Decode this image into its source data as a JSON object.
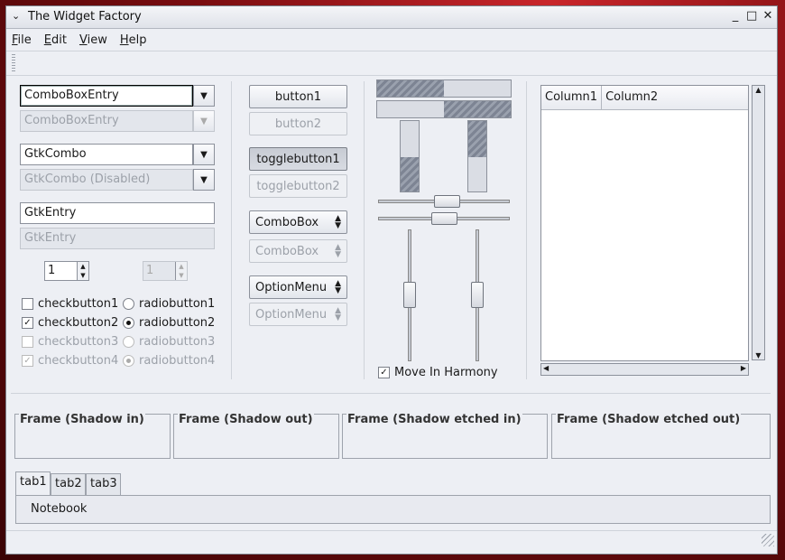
{
  "window": {
    "title": "The Widget Factory",
    "controls": [
      "_",
      "□",
      "✕"
    ]
  },
  "menu": [
    "File",
    "Edit",
    "View",
    "Help"
  ],
  "left": {
    "combobox_entry": "ComboBoxEntry",
    "combobox_entry_disabled": "ComboBoxEntry",
    "gtkcombo": "GtkCombo",
    "gtkcombo_disabled": "GtkCombo (Disabled)",
    "gtkentry": "GtkEntry",
    "gtkentry_disabled": "GtkEntry",
    "spin_value": "1",
    "spin_disabled_value": "1",
    "checks": [
      "checkbutton1",
      "checkbutton2",
      "checkbutton3",
      "checkbutton4"
    ],
    "radios": [
      "radiobutton1",
      "radiobutton2",
      "radiobutton3",
      "radiobutton4"
    ]
  },
  "middle": {
    "button1": "button1",
    "button2": "button2",
    "toggle1": "togglebutton1",
    "toggle2": "togglebutton2",
    "combobox": "ComboBox",
    "combobox_disabled": "ComboBox",
    "optionmenu": "OptionMenu",
    "optionmenu_disabled": "OptionMenu"
  },
  "right_mid": {
    "progress_h1": 0.5,
    "progress_h2": 0.5,
    "harmony_label": "Move In Harmony"
  },
  "tree": {
    "columns": [
      "Column1",
      "Column2"
    ]
  },
  "frames": [
    "Frame (Shadow in)",
    "Frame (Shadow out)",
    "Frame (Shadow etched in)",
    "Frame (Shadow etched out)"
  ],
  "tabs": [
    "tab1",
    "tab2",
    "tab3"
  ],
  "notebook_content": "Notebook"
}
